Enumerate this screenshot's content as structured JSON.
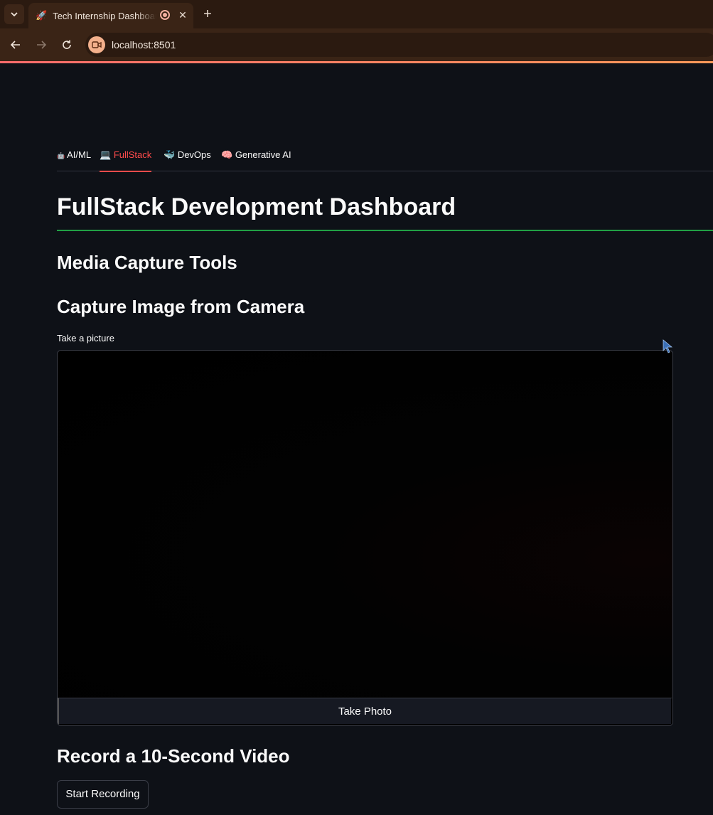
{
  "browser": {
    "tab_title": "Tech Internship Dashboard",
    "tab_favicon": "🚀",
    "url": "localhost:8501"
  },
  "app_tabs": [
    {
      "icon": "🤖",
      "label": "AI/ML"
    },
    {
      "icon": "💻",
      "label": "FullStack"
    },
    {
      "icon": "🐳",
      "label": "DevOps"
    },
    {
      "icon": "🧠",
      "label": "Generative AI"
    }
  ],
  "active_tab": "FullStack",
  "page": {
    "title": "FullStack Development Dashboard",
    "section_title": "Media Capture Tools",
    "camera_heading": "Capture Image from Camera",
    "camera_label": "Take a picture",
    "take_photo_label": "Take Photo",
    "video_heading": "Record a 10-Second Video",
    "start_recording_label": "Start Recording"
  },
  "colors": {
    "accent": "#ff4b4b",
    "title_rule": "#21a045",
    "background": "#0e1117"
  }
}
